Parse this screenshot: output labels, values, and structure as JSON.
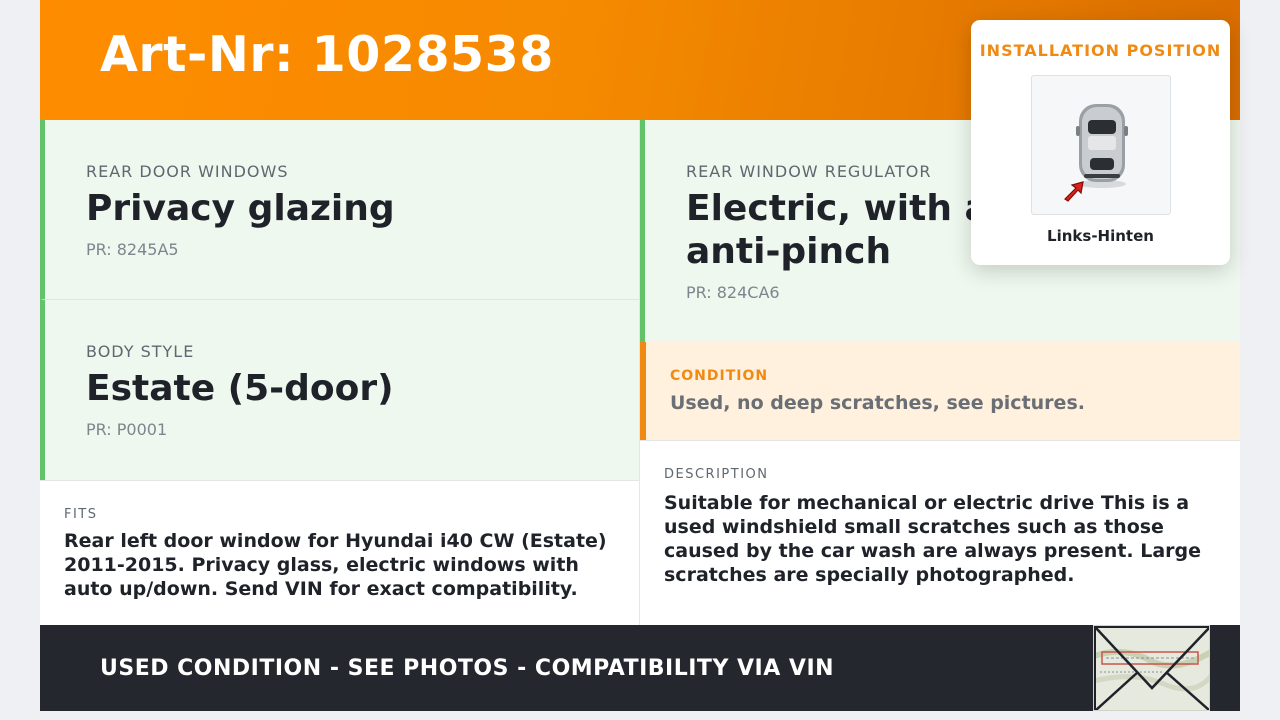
{
  "header": {
    "title": "Art-Nr: 1028538"
  },
  "cells": [
    {
      "label": "REAR DOOR WINDOWS",
      "value": "Privacy glazing",
      "pr": "PR: 8245A5"
    },
    {
      "label": "BODY STYLE",
      "value": "Estate (5-door)",
      "pr": "PR: P0001"
    },
    {
      "label": "REAR WINDOW REGULATOR",
      "value": "Electric, with auto and anti-pinch",
      "pr": "PR: 824CA6"
    }
  ],
  "condition": {
    "label": "CONDITION",
    "text": "Used, no deep scratches, see pictures."
  },
  "fits": {
    "label": "FITS",
    "text": "Rear left door window for Hyundai i40 CW (Estate) 2011-2015. Privacy glass, electric windows with auto up/down. Send VIN for exact compatibility."
  },
  "description": {
    "label": "DESCRIPTION",
    "text": "Suitable for mechanical or electric drive This is a used windshield small scratches such as those caused by the car wash are always present. Large scratches are specially photographed."
  },
  "footer": {
    "text": "USED CONDITION - SEE PHOTOS - COMPATIBILITY VIA VIN"
  },
  "installation": {
    "title": "INSTALLATION POSITION",
    "position": "Links-Hinten"
  },
  "colors": {
    "accent": "#ff8c00",
    "green": "#62c36a",
    "condition_bg": "#fff1de",
    "footer_bg": "#24272d"
  }
}
